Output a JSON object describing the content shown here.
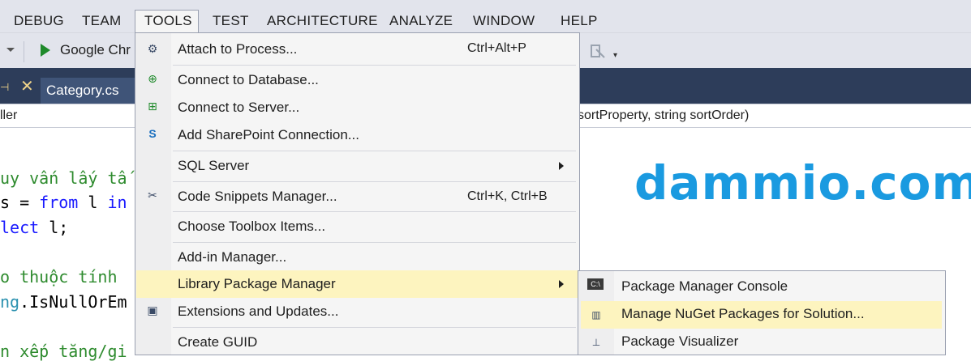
{
  "menubar": {
    "items": [
      "DEBUG",
      "TEAM",
      "TOOLS",
      "TEST",
      "ARCHITECTURE",
      "ANALYZE",
      "WINDOW",
      "HELP"
    ],
    "open_menu": "TOOLS"
  },
  "toolbar": {
    "run_target_label": "Google Chr"
  },
  "tabs": {
    "active_file": "Category.cs"
  },
  "navbar": {
    "left_text": "ller",
    "right_text": "sortProperty, string sortOrder)"
  },
  "editor": {
    "lines": [
      {
        "comment": "uy vấn lấy tấ"
      },
      {
        "a": "s = ",
        "kw1": "from",
        "b": " l ",
        "kw2": "in"
      },
      {
        "kw": "lect",
        "b": " l;"
      },
      {
        "comment": "o thuộc tính"
      },
      {
        "ty": "ng",
        "b": ".IsNullOrEm"
      },
      {
        "comment": "n xếp tăng/gi"
      }
    ]
  },
  "watermark": "dammio.com",
  "tools_menu": {
    "items": [
      {
        "label": "Attach to Process...",
        "shortcut": "Ctrl+Alt+P",
        "icon": "gears-icon"
      },
      {
        "label": "Connect to Database...",
        "shortcut": "",
        "icon": "database-plug-icon"
      },
      {
        "label": "Connect to Server...",
        "shortcut": "",
        "icon": "server-plug-icon"
      },
      {
        "label": "Add SharePoint Connection...",
        "shortcut": "",
        "icon": "sharepoint-icon"
      },
      {
        "label": "SQL Server",
        "shortcut": "",
        "icon": "",
        "submenu": true
      },
      {
        "label": "Code Snippets Manager...",
        "shortcut": "Ctrl+K, Ctrl+B",
        "icon": "snippet-icon"
      },
      {
        "label": "Choose Toolbox Items...",
        "shortcut": "",
        "icon": ""
      },
      {
        "label": "Add-in Manager...",
        "shortcut": "",
        "icon": ""
      },
      {
        "label": "Library Package Manager",
        "shortcut": "",
        "icon": "",
        "submenu": true,
        "highlighted": true
      },
      {
        "label": "Extensions and Updates...",
        "shortcut": "",
        "icon": "extensions-icon"
      },
      {
        "label": "Create GUID",
        "shortcut": "",
        "icon": ""
      }
    ]
  },
  "submenu": {
    "items": [
      {
        "label": "Package Manager Console",
        "icon": "console-icon",
        "icon_text": "C:\\"
      },
      {
        "label": "Manage NuGet Packages for Solution...",
        "icon": "nuget-packages-icon",
        "highlighted": true
      },
      {
        "label": "Package Visualizer",
        "icon": "hierarchy-icon"
      }
    ]
  },
  "colors": {
    "accent_highlight": "#fdf4bf",
    "watermark": "#1a9ae0",
    "tab_bar": "#2d3d5a"
  }
}
